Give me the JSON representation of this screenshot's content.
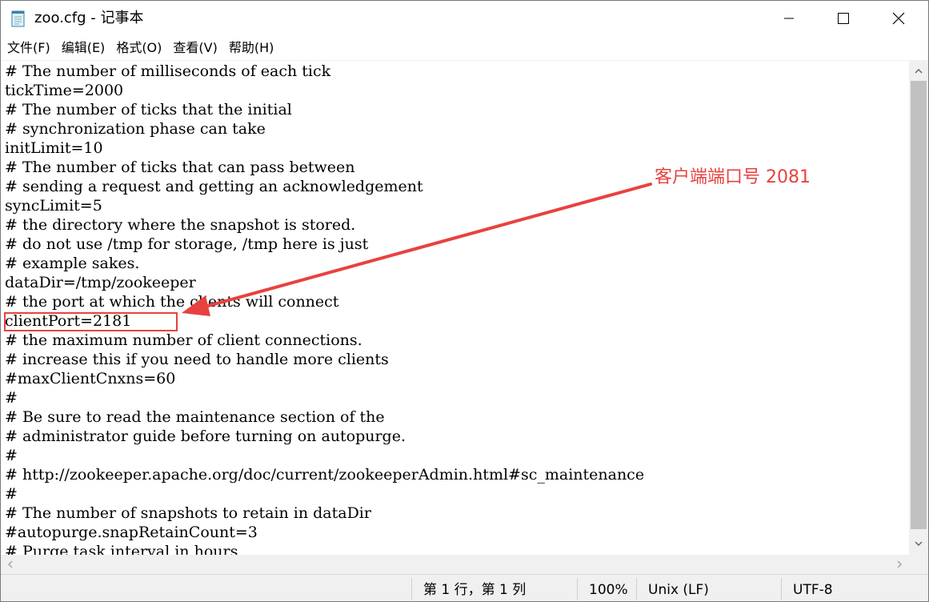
{
  "window": {
    "title": "zoo.cfg - 记事本"
  },
  "menu": [
    {
      "label": "文件(F)"
    },
    {
      "label": "编辑(E)"
    },
    {
      "label": "格式(O)"
    },
    {
      "label": "查看(V)"
    },
    {
      "label": "帮助(H)"
    }
  ],
  "editor": {
    "lines": [
      "# The number of milliseconds of each tick",
      "tickTime=2000",
      "# The number of ticks that the initial",
      "# synchronization phase can take",
      "initLimit=10",
      "# The number of ticks that can pass between",
      "# sending a request and getting an acknowledgement",
      "syncLimit=5",
      "# the directory where the snapshot is stored.",
      "# do not use /tmp for storage, /tmp here is just",
      "# example sakes.",
      "dataDir=/tmp/zookeeper",
      "# the port at which the clients will connect",
      "clientPort=2181",
      "# the maximum number of client connections.",
      "# increase this if you need to handle more clients",
      "#maxClientCnxns=60",
      "#",
      "# Be sure to read the maintenance section of the",
      "# administrator guide before turning on autopurge.",
      "#",
      "# http://zookeeper.apache.org/doc/current/zookeeperAdmin.html#sc_maintenance",
      "#",
      "# The number of snapshots to retain in dataDir",
      "#autopurge.snapRetainCount=3",
      "# Purge task interval in hours"
    ]
  },
  "status": {
    "position": "第 1 行，第 1 列",
    "zoom": "100%",
    "line_ending": "Unix (LF)",
    "encoding": "UTF-8"
  },
  "annotation": {
    "text": "客户端端口号 2081",
    "color": "#e8423f"
  }
}
